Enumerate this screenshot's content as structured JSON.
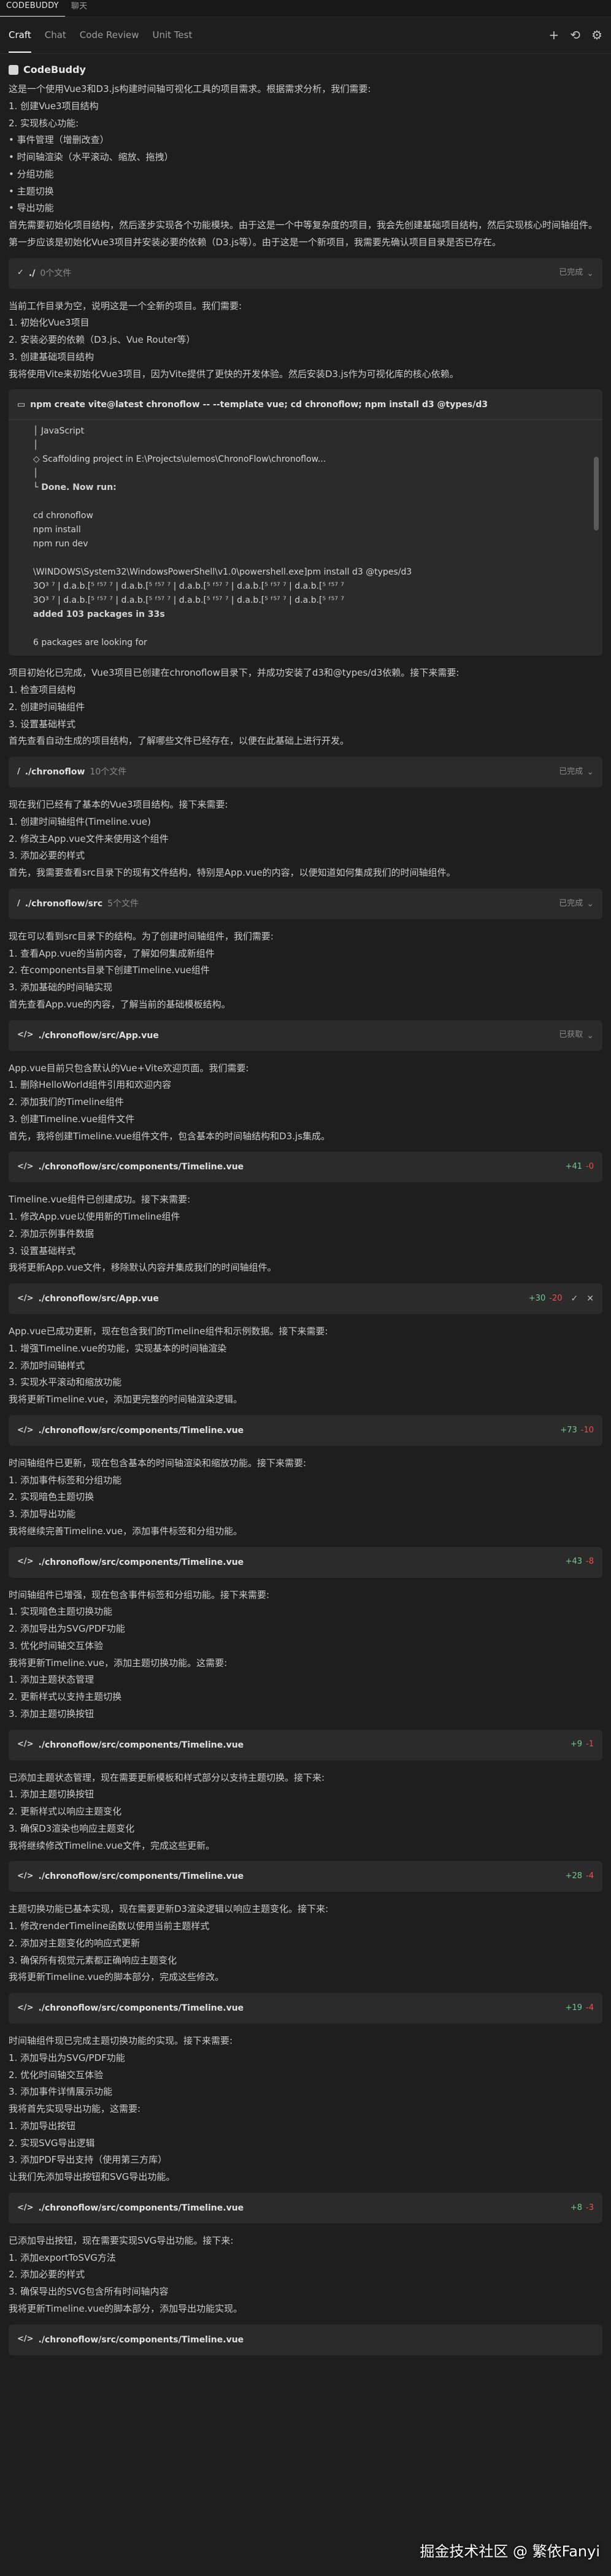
{
  "window_tabs": [
    "CODEBUDDY",
    "聊天"
  ],
  "tabs": [
    "Craft",
    "Chat",
    "Code Review",
    "Unit Test"
  ],
  "header_title": "CodeBuddy",
  "blocks": [
    {
      "type": "text",
      "lines": [
        "这是一个使用Vue3和D3.js构建时间轴可视化工具的项目需求。根据需求分析，我们需要:",
        "1. 创建Vue3项目结构",
        "2. 实现核心功能:",
        "• 事件管理（增删改查）",
        "• 时间轴渲染（水平滚动、缩放、拖拽）",
        "• 分组功能",
        "• 主题切换",
        "• 导出功能",
        "首先需要初始化项目结构，然后逐步实现各个功能模块。由于这是一个中等复杂度的项目，我会先创建基础项目结构，然后实现核心时间轴组件。",
        "第一步应该是初始化Vue3项目并安装必要的依赖（D3.js等）。由于这是一个新项目，我需要先确认项目目录是否已存在。"
      ]
    },
    {
      "type": "card",
      "icon": "✓",
      "path": "./",
      "meta": "0个文件",
      "status": "已完成"
    },
    {
      "type": "text",
      "lines": [
        "当前工作目录为空，说明这是一个全新的项目。我们需要:",
        "1. 初始化Vue3项目",
        "2. 安装必要的依赖（D3.js、Vue Router等）",
        "3. 创建基础项目结构",
        "我将使用Vite来初始化Vue3项目，因为Vite提供了更快的开发体验。然后安装D3.js作为可视化库的核心依赖。"
      ]
    },
    {
      "type": "terminal",
      "title": "npm create vite@latest chronoflow -- --template vue; cd chronoflow; npm install d3 @types/d3",
      "lines": [
        "│  JavaScript",
        "│",
        "◇  Scaffolding project in E:\\Projects\\ulemos\\ChronoFlow\\chronoflow...",
        "│",
        "└  Done. Now run:",
        "",
        "  cd chronoflow",
        "  npm install",
        "  npm run dev",
        "",
        "\\WINDOWS\\System32\\WindowsPowerShell\\v1.0\\powershell.exe]pm install d3 @types/d3",
        "3Ο³ ⁷ | d.a.b.[⁵ ᶠ⁵⁷ ⁷ | d.a.b.[⁵ ᶠ⁵⁷ ⁷ | d.a.b.[⁵ ᶠ⁵⁷ ⁷ | d.a.b.[⁵ ᶠ⁵⁷ ⁷ | d.a.b.[⁵ ᶠ⁵⁷ ⁷",
        "3Ο³ ⁷ | d.a.b.[⁵ ᶠ⁵⁷ ⁷ | d.a.b.[⁵ ᶠ⁵⁷ ⁷ | d.a.b.[⁵ ᶠ⁵⁷ ⁷ | d.a.b.[⁵ ᶠ⁵⁷ ⁷ | d.a.b.[⁵ ᶠ⁵⁷ ⁷",
        "added 103 packages in 33s",
        "",
        "6 packages are looking for"
      ]
    },
    {
      "type": "text",
      "lines": [
        "项目初始化已完成，Vue3项目已创建在chronoflow目录下，并成功安装了d3和@types/d3依赖。接下来需要:",
        "1. 检查项目结构",
        "2. 创建时间轴组件",
        "3. 设置基础样式",
        "首先查看自动生成的项目结构，了解哪些文件已经存在，以便在此基础上进行开发。"
      ]
    },
    {
      "type": "card",
      "icon": "/",
      "path": "./chronoflow",
      "meta": "10个文件",
      "status": "已完成"
    },
    {
      "type": "text",
      "lines": [
        "现在我们已经有了基本的Vue3项目结构。接下来需要:",
        "1. 创建时间轴组件(Timeline.vue)",
        "2. 修改主App.vue文件来使用这个组件",
        "3. 添加必要的样式",
        "首先，我需要查看src目录下的现有文件结构，特别是App.vue的内容，以便知道如何集成我们的时间轴组件。"
      ]
    },
    {
      "type": "card",
      "icon": "/",
      "path": "./chronoflow/src",
      "meta": "5个文件",
      "status": "已完成"
    },
    {
      "type": "text",
      "lines": [
        "现在可以看到src目录下的结构。为了创建时间轴组件，我们需要:",
        "1. 查看App.vue的当前内容，了解如何集成新组件",
        "2. 在components目录下创建Timeline.vue组件",
        "3. 添加基础的时间轴实现",
        "首先查看App.vue的内容，了解当前的基础模板结构。"
      ]
    },
    {
      "type": "card",
      "icon": "</>",
      "path": "./chronoflow/src/App.vue",
      "meta": "",
      "status": "已获取"
    },
    {
      "type": "text",
      "lines": [
        "App.vue目前只包含默认的Vue+Vite欢迎页面。我们需要:",
        "1. 删除HelloWorld组件引用和欢迎内容",
        "2. 添加我们的Timeline组件",
        "3. 创建Timeline.vue组件文件",
        "首先，我将创建Timeline.vue组件文件，包含基本的时间轴结构和D3.js集成。"
      ]
    },
    {
      "type": "diff",
      "path": "./chronoflow/src/components/Timeline.vue",
      "plus": "+41",
      "minus": "-0",
      "tools": false
    },
    {
      "type": "text",
      "lines": [
        "Timeline.vue组件已创建成功。接下来需要:",
        "1. 修改App.vue以使用新的Timeline组件",
        "2. 添加示例事件数据",
        "3. 设置基础样式",
        "我将更新App.vue文件，移除默认内容并集成我们的时间轴组件。"
      ]
    },
    {
      "type": "diff",
      "path": "./chronoflow/src/App.vue",
      "plus": "+30",
      "minus": "-20",
      "tools": true
    },
    {
      "type": "text",
      "lines": [
        "App.vue已成功更新，现在包含我们的Timeline组件和示例数据。接下来需要:",
        "1. 增强Timeline.vue的功能，实现基本的时间轴渲染",
        "2. 添加时间轴样式",
        "3. 实现水平滚动和缩放功能",
        "我将更新Timeline.vue，添加更完整的时间轴渲染逻辑。"
      ]
    },
    {
      "type": "diff",
      "path": "./chronoflow/src/components/Timeline.vue",
      "plus": "+73",
      "minus": "-10",
      "tools": false
    },
    {
      "type": "text",
      "lines": [
        "时间轴组件已更新，现在包含基本的时间轴渲染和缩放功能。接下来需要:",
        "1. 添加事件标签和分组功能",
        "2. 实现暗色主题切换",
        "3. 添加导出功能",
        "我将继续完善Timeline.vue，添加事件标签和分组功能。"
      ]
    },
    {
      "type": "diff",
      "path": "./chronoflow/src/components/Timeline.vue",
      "plus": "+43",
      "minus": "-8",
      "tools": false
    },
    {
      "type": "text",
      "lines": [
        "时间轴组件已增强，现在包含事件标签和分组功能。接下来需要:",
        "1. 实现暗色主题切换功能",
        "2. 添加导出为SVG/PDF功能",
        "3. 优化时间轴交互体验",
        "我将更新Timeline.vue，添加主题切换功能。这需要:",
        "1. 添加主题状态管理",
        "2. 更新样式以支持主题切换",
        "3. 添加主题切换按钮"
      ]
    },
    {
      "type": "diff",
      "path": "./chronoflow/src/components/Timeline.vue",
      "plus": "+9",
      "minus": "-1",
      "tools": false
    },
    {
      "type": "text",
      "lines": [
        "已添加主题状态管理，现在需要更新模板和样式部分以支持主题切换。接下来:",
        "1. 添加主题切换按钮",
        "2. 更新样式以响应主题变化",
        "3. 确保D3渲染也响应主题变化",
        "我将继续修改Timeline.vue文件，完成这些更新。"
      ]
    },
    {
      "type": "diff",
      "path": "./chronoflow/src/components/Timeline.vue",
      "plus": "+28",
      "minus": "-4",
      "tools": false
    },
    {
      "type": "text",
      "lines": [
        "主题切换功能已基本实现，现在需要更新D3渲染逻辑以响应主题变化。接下来:",
        "1. 修改renderTimeline函数以使用当前主题样式",
        "2. 添加对主题变化的响应式更新",
        "3. 确保所有视觉元素都正确响应主题变化",
        "我将更新Timeline.vue的脚本部分，完成这些修改。"
      ]
    },
    {
      "type": "diff",
      "path": "./chronoflow/src/components/Timeline.vue",
      "plus": "+19",
      "minus": "-4",
      "tools": false
    },
    {
      "type": "text",
      "lines": [
        "时间轴组件现已完成主题切换功能的实现。接下来需要:",
        "1. 添加导出为SVG/PDF功能",
        "2. 优化时间轴交互体验",
        "3. 添加事件详情展示功能",
        "我将首先实现导出功能，这需要:",
        "1. 添加导出按钮",
        "2. 实现SVG导出逻辑",
        "3. 添加PDF导出支持（使用第三方库）",
        "让我们先添加导出按钮和SVG导出功能。"
      ]
    },
    {
      "type": "diff",
      "path": "./chronoflow/src/components/Timeline.vue",
      "plus": "+8",
      "minus": "-3",
      "tools": false
    },
    {
      "type": "text",
      "lines": [
        "已添加导出按钮，现在需要实现SVG导出功能。接下来:",
        "1. 添加exportToSVG方法",
        "2. 添加必要的样式",
        "3. 确保导出的SVG包含所有时间轴内容",
        "我将更新Timeline.vue的脚本部分，添加导出功能实现。"
      ]
    },
    {
      "type": "diff",
      "path": "./chronoflow/src/components/Timeline.vue",
      "plus": "",
      "minus": "",
      "tools": false
    }
  ],
  "watermark": "掘金技术社区 @ 繁依Fanyi"
}
